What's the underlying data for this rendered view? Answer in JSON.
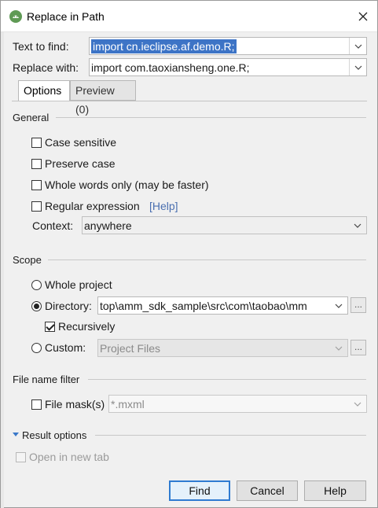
{
  "window": {
    "title": "Replace in Path",
    "close_icon": "close-icon",
    "app_icon": "android-studio-icon"
  },
  "find": {
    "label": "Text to find:",
    "value": "import cn.ieclipse.af.demo.R;"
  },
  "replace": {
    "label": "Replace with:",
    "value": "import com.taoxiansheng.one.R;"
  },
  "tabs": [
    {
      "label": "Options",
      "active": true
    },
    {
      "label": "Preview (0)",
      "active": false
    }
  ],
  "general": {
    "title": "General",
    "case_sensitive": {
      "label": "Case sensitive",
      "checked": false
    },
    "preserve_case": {
      "label": "Preserve case",
      "checked": false
    },
    "whole_words": {
      "label": "Whole words only (may be faster)",
      "checked": false
    },
    "regex": {
      "label": "Regular expression",
      "checked": false,
      "help": "[Help]"
    },
    "context": {
      "label": "Context:",
      "value": "anywhere"
    }
  },
  "scope": {
    "title": "Scope",
    "whole_project": {
      "label": "Whole project",
      "selected": false
    },
    "directory": {
      "label": "Directory:",
      "selected": true,
      "value": "top\\amm_sdk_sample\\src\\com\\taobao\\mm",
      "browse": "..."
    },
    "recursively": {
      "label": "Recursively",
      "checked": true
    },
    "custom": {
      "label": "Custom:",
      "selected": false,
      "value": "Project Files",
      "browse": "..."
    }
  },
  "file_filter": {
    "title": "File name filter",
    "mask": {
      "label": "File mask(s)",
      "checked": false,
      "value": "*.mxml"
    }
  },
  "result_options": {
    "title": "Result options",
    "open_new_tab": {
      "label": "Open in new tab",
      "checked": false
    }
  },
  "buttons": {
    "find": "Find",
    "cancel": "Cancel",
    "help": "Help"
  },
  "colors": {
    "accent": "#3d74c6",
    "link": "#4a6fb0",
    "primary_border": "#2f7bd1"
  }
}
